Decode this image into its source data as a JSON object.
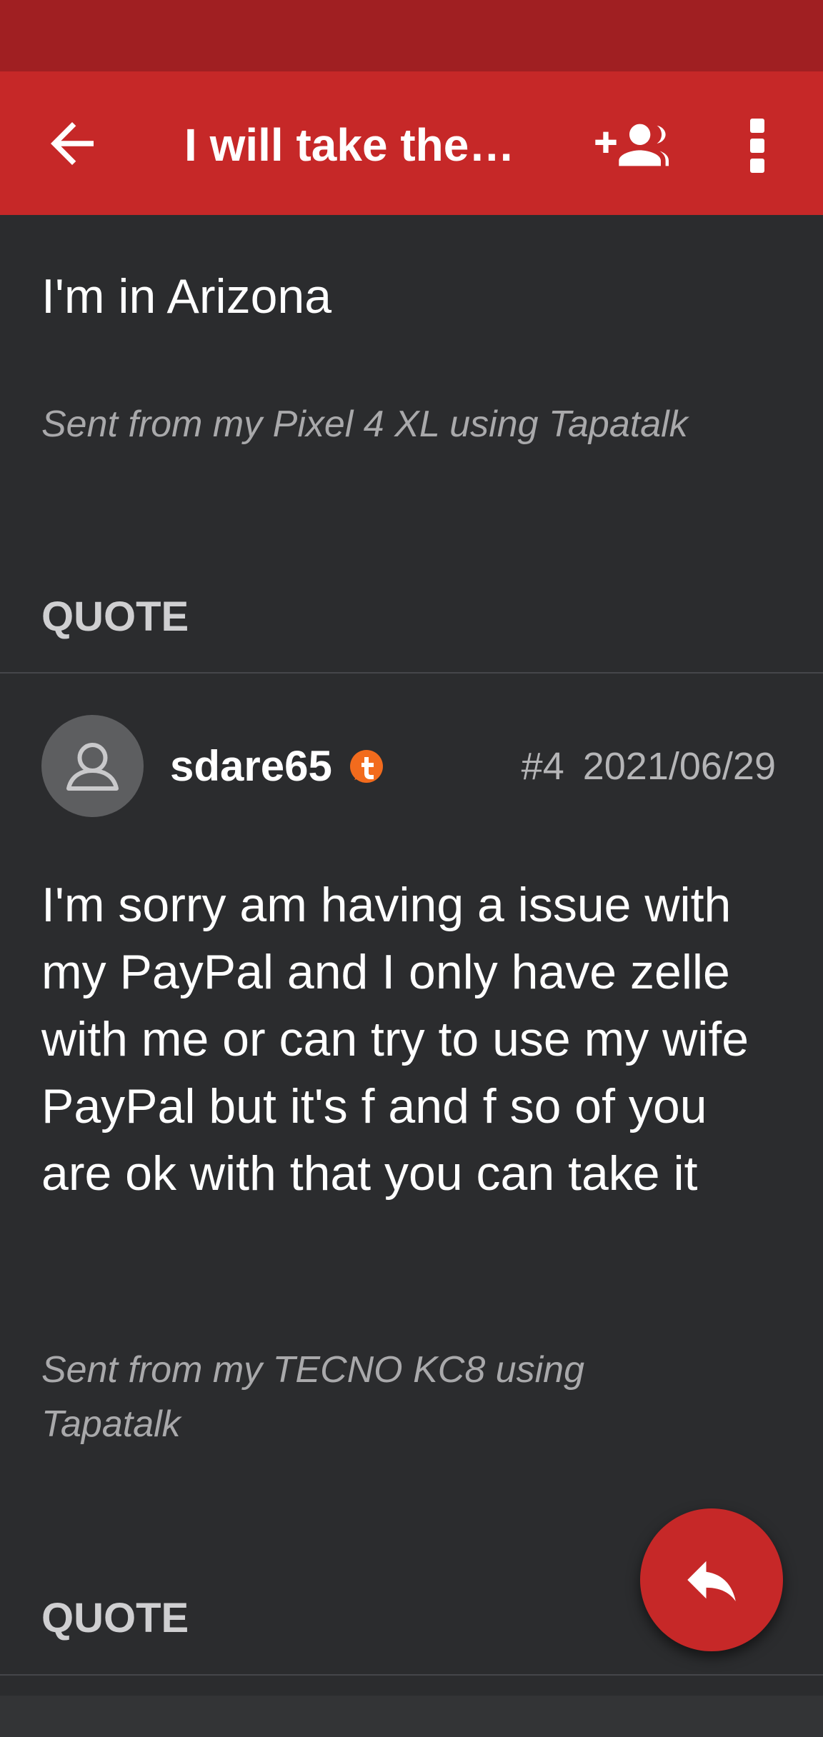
{
  "app": {
    "title": "I will take the…",
    "accent": "#c62828",
    "statusbar_color": "#a01f22"
  },
  "icons": {
    "back": "arrow-back-icon",
    "add_person": "add-person-icon",
    "more": "more-vert-icon",
    "avatar": "person-icon",
    "badge": "tapatalk-badge-icon",
    "reply": "reply-icon"
  },
  "posts": [
    {
      "body": "I'm in Arizona",
      "signature": "Sent from my Pixel 4 XL using Tapatalk",
      "quote_label": "QUOTE"
    },
    {
      "username": "sdare65",
      "post_number": "#4",
      "date": "2021/06/29",
      "body": "I'm sorry am having a issue with my PayPal and I only have zelle with me or can try to use my wife PayPal but it's f and f so of you are ok with that you can take it",
      "signature": "Sent from my TECNO KC8 using Tapatalk",
      "quote_label": "QUOTE"
    }
  ]
}
